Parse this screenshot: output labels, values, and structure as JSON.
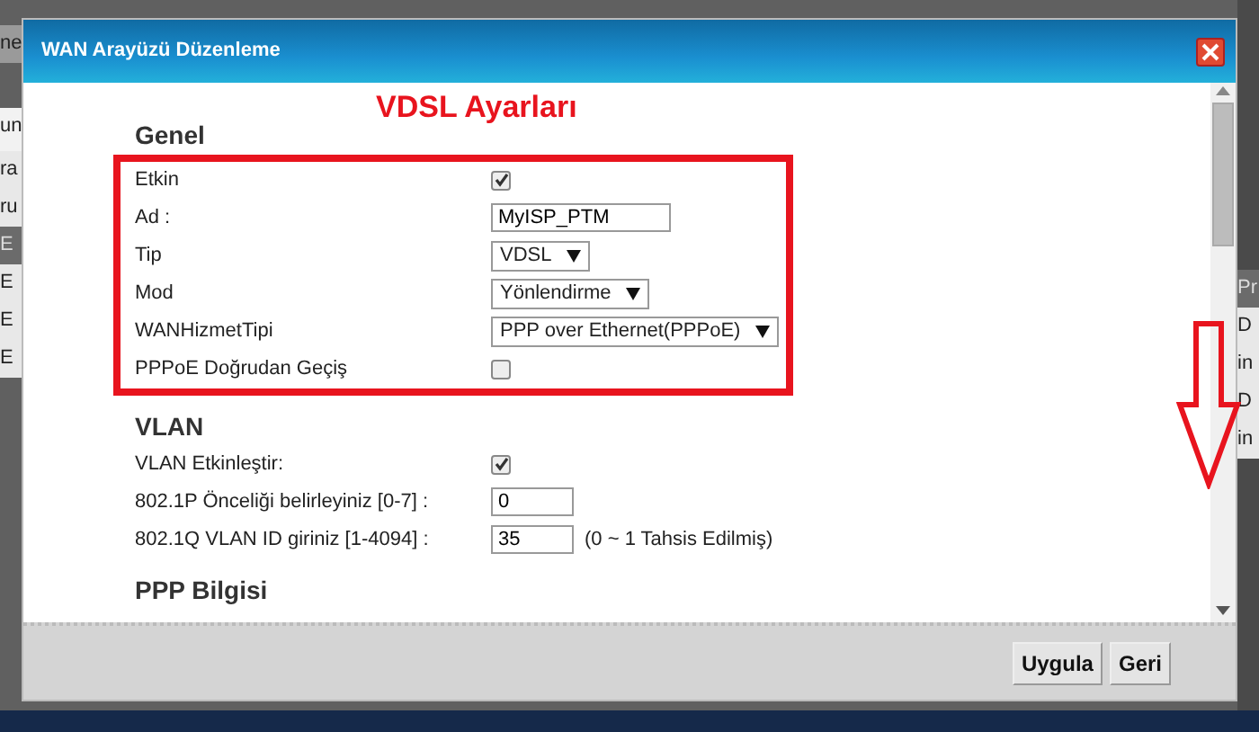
{
  "backdrop": {
    "left": [
      {
        "text": "ne",
        "kind": "top"
      },
      {
        "text": "un",
        "kind": "heading"
      },
      {
        "text": "ra",
        "kind": "cell"
      },
      {
        "text": "ru",
        "kind": "cell"
      },
      {
        "text": "E",
        "kind": "header"
      },
      {
        "text": "E",
        "kind": "cell"
      },
      {
        "text": "E",
        "kind": "cell"
      },
      {
        "text": "E",
        "kind": "cell"
      }
    ],
    "right": [
      {
        "text": "Pr",
        "kind": "header"
      },
      {
        "text": "D",
        "kind": "cell"
      },
      {
        "text": "in",
        "kind": "cell"
      },
      {
        "text": "D",
        "kind": "cell"
      },
      {
        "text": "in",
        "kind": "cell"
      }
    ]
  },
  "dialog": {
    "title": "WAN Arayüzü Düzenleme"
  },
  "annotation": {
    "text": "VDSL Ayarları"
  },
  "sections": [
    {
      "heading": "Genel",
      "highlighted": true,
      "fields": [
        {
          "kind": "checkbox",
          "label": "Etkin",
          "checked": true
        },
        {
          "kind": "text",
          "label": "Ad :",
          "value": "MyISP_PTM"
        },
        {
          "kind": "select",
          "label": "Tip",
          "value": "VDSL"
        },
        {
          "kind": "select",
          "label": "Mod",
          "value": "Yönlendirme"
        },
        {
          "kind": "select",
          "label": "WANHizmetTipi",
          "value": "PPP over Ethernet(PPPoE)"
        },
        {
          "kind": "checkbox",
          "label": "PPPoE Doğrudan Geçiş",
          "checked": false
        }
      ]
    },
    {
      "heading": "VLAN",
      "fields": [
        {
          "kind": "checkbox",
          "label": "VLAN Etkinleştir:",
          "checked": true
        },
        {
          "kind": "text",
          "label": "802.1P Önceliği belirleyiniz [0-7] :",
          "value": "0"
        },
        {
          "kind": "text",
          "label": "802.1Q VLAN ID giriniz [1-4094] :",
          "value": "35",
          "note": "(0 ~ 1 Tahsis Edilmiş)"
        }
      ]
    },
    {
      "heading": "PPP Bilgisi"
    }
  ],
  "buttons": [
    "Uygula",
    "Geri"
  ]
}
